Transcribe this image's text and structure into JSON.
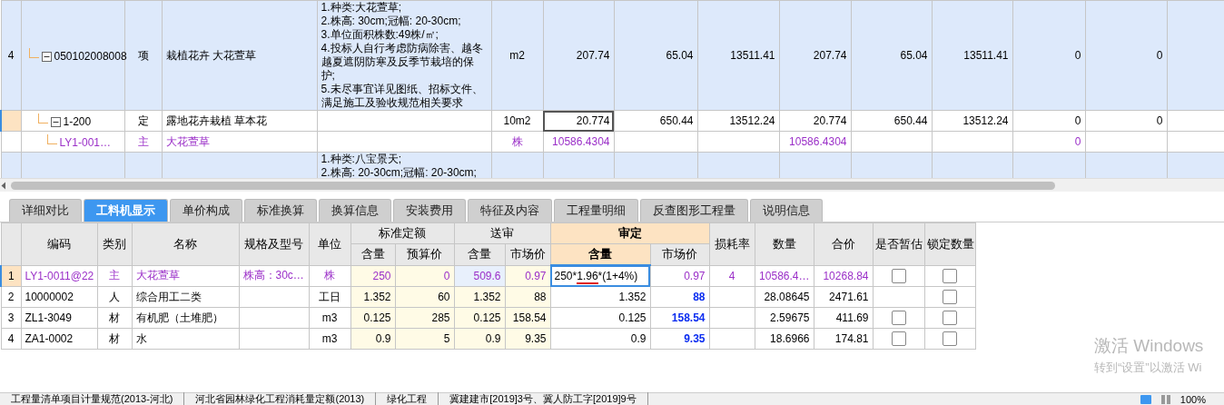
{
  "bill_table": {
    "rows": [
      {
        "index": "4",
        "code": "050102008008",
        "type": "项",
        "name": "栽植花卉 大花萱草",
        "features": "1.种类:大花萱草;\n2.株高: 30cm;冠幅: 20-30cm;\n3.单位面积株数:49株/㎡;\n4.投标人自行考虑防病除害、越冬越夏遮阴防寒及反季节栽培的保护;\n5.未尽事宜详见图纸、招标文件、满足施工及验收规范相关要求",
        "unit": "m2",
        "values": {
          "column_7": "207.74",
          "column_8": "65.04",
          "column_9": "13511.41",
          "column_10": "207.74",
          "column_11": "65.04",
          "column_12": "13511.41",
          "column_13": "0",
          "column_14": "0"
        },
        "kind": "bill",
        "selected": false,
        "expanded": true,
        "children": [
          {
            "code": "1-200",
            "type": "定",
            "name": "露地花卉栽植 草本花",
            "unit": "10m2",
            "values": {
              "column_7": "20.774",
              "column_8": "650.44",
              "column_9": "13512.24",
              "column_10": "20.774",
              "column_11": "650.44",
              "column_12": "13512.24",
              "column_13": "0",
              "column_14": "0"
            },
            "kind": "quota",
            "selected": true,
            "expanded": true,
            "children": [
              {
                "code": "LY1-001…",
                "type": "主",
                "name": "大花萱草",
                "unit": "株",
                "values": {
                  "column_7": "10586.4304",
                  "column_10": "10586.4304",
                  "column_13": "0"
                },
                "kind": "material",
                "selected": false
              }
            ]
          }
        ]
      },
      {
        "features": "1.种类:八宝景天;\n2.株高: 20-30cm;冠幅: 20-30cm;",
        "kind": "bill",
        "selected": false
      }
    ]
  },
  "tabs": [
    {
      "label": "详细对比",
      "selected": false
    },
    {
      "label": "工料机显示",
      "selected": true
    },
    {
      "label": "单价构成",
      "selected": false
    },
    {
      "label": "标准换算",
      "selected": false
    },
    {
      "label": "换算信息",
      "selected": false
    },
    {
      "label": "安装费用",
      "selected": false
    },
    {
      "label": "特征及内容",
      "selected": false
    },
    {
      "label": "工程量明细",
      "selected": false
    },
    {
      "label": "反查图形工程量",
      "selected": false
    },
    {
      "label": "说明信息",
      "selected": false
    }
  ],
  "material_table": {
    "columns": [
      {
        "selected": false
      },
      {
        "label": "编码",
        "selected": false
      },
      {
        "label": "类别",
        "selected": false
      },
      {
        "label": "名称",
        "selected": false
      },
      {
        "label": "规格及型号",
        "selected": false
      },
      {
        "label": "单位",
        "selected": false
      },
      {
        "label": "标准定额",
        "selected": false,
        "children": [
          {
            "label": "含量",
            "selected": false
          },
          {
            "label": "预算价",
            "selected": false
          }
        ]
      },
      {
        "label": "送审",
        "selected": false,
        "children": [
          {
            "label": "含量",
            "selected": false
          },
          {
            "label": "市场价",
            "selected": false
          }
        ]
      },
      {
        "label": "审定",
        "selected": true,
        "children": [
          {
            "label": "含量",
            "selected": true
          },
          {
            "label": "市场价",
            "selected": false
          }
        ]
      },
      {
        "label": "损耗率",
        "selected": false
      },
      {
        "label": "数量",
        "selected": false
      },
      {
        "label": "合价",
        "selected": false
      },
      {
        "label": "是否暂估",
        "selected": false
      },
      {
        "label": "锁定数量",
        "selected": false
      }
    ],
    "rows": [
      {
        "index": "1",
        "code": "LY1-0011@22",
        "type": "主",
        "name": "大花萱草",
        "spec": "株高：30c…",
        "unit": "株",
        "std_qty": "250",
        "std_price": "0",
        "sub_qty": "509.6",
        "sub_price": "0.97",
        "aud_qty": {
          "kind": "formula",
          "before": "250*",
          "marked": "1.96",
          "after": "*(1+4%)"
        },
        "aud_price": "0.97",
        "loss_rate": "4",
        "amount": "10586.4…",
        "total": "10268.84",
        "kind": "main",
        "selected": true,
        "price_changed": false,
        "submitted_changed": true,
        "provisional": false,
        "locked": false
      },
      {
        "index": "2",
        "code": "10000002",
        "type": "人",
        "name": "综合用工二类",
        "unit": "工日",
        "std_qty": "1.352",
        "std_price": "60",
        "sub_qty": "1.352",
        "sub_price": "88",
        "aud_qty": "1.352",
        "aud_price": "88",
        "amount": "28.08645",
        "total": "2471.61",
        "kind": "normal",
        "selected": false,
        "price_changed": true,
        "submitted_changed": false,
        "locked": false
      },
      {
        "index": "3",
        "code": "ZL1-3049",
        "type": "材",
        "name": "有机肥（土堆肥）",
        "unit": "m3",
        "std_qty": "0.125",
        "std_price": "285",
        "sub_qty": "0.125",
        "sub_price": "158.54",
        "aud_qty": "0.125",
        "aud_price": "158.54",
        "amount": "2.59675",
        "total": "411.69",
        "kind": "normal",
        "selected": false,
        "price_changed": true,
        "submitted_changed": false,
        "provisional": false,
        "locked": false
      },
      {
        "index": "4",
        "code": "ZA1-0002",
        "type": "材",
        "name": "水",
        "unit": "m3",
        "std_qty": "0.9",
        "std_price": "5",
        "sub_qty": "0.9",
        "sub_price": "9.35",
        "aud_qty": "0.9",
        "aud_price": "9.35",
        "amount": "18.6966",
        "total": "174.81",
        "kind": "normal",
        "selected": false,
        "price_changed": true,
        "submitted_changed": false,
        "provisional": false,
        "locked": false
      }
    ]
  },
  "activation_notice": {
    "title": "激活 Windows",
    "hint": "转到“设置”以激活 Wi"
  },
  "status_bar": {
    "items": [
      "工程量清单项目计量规范(2013-河北)",
      "河北省园林绿化工程消耗量定额(2013)",
      "绿化工程",
      "冀建建市[2019]3号、冀人防工字[2019]9号"
    ],
    "zoom": "100%"
  }
}
